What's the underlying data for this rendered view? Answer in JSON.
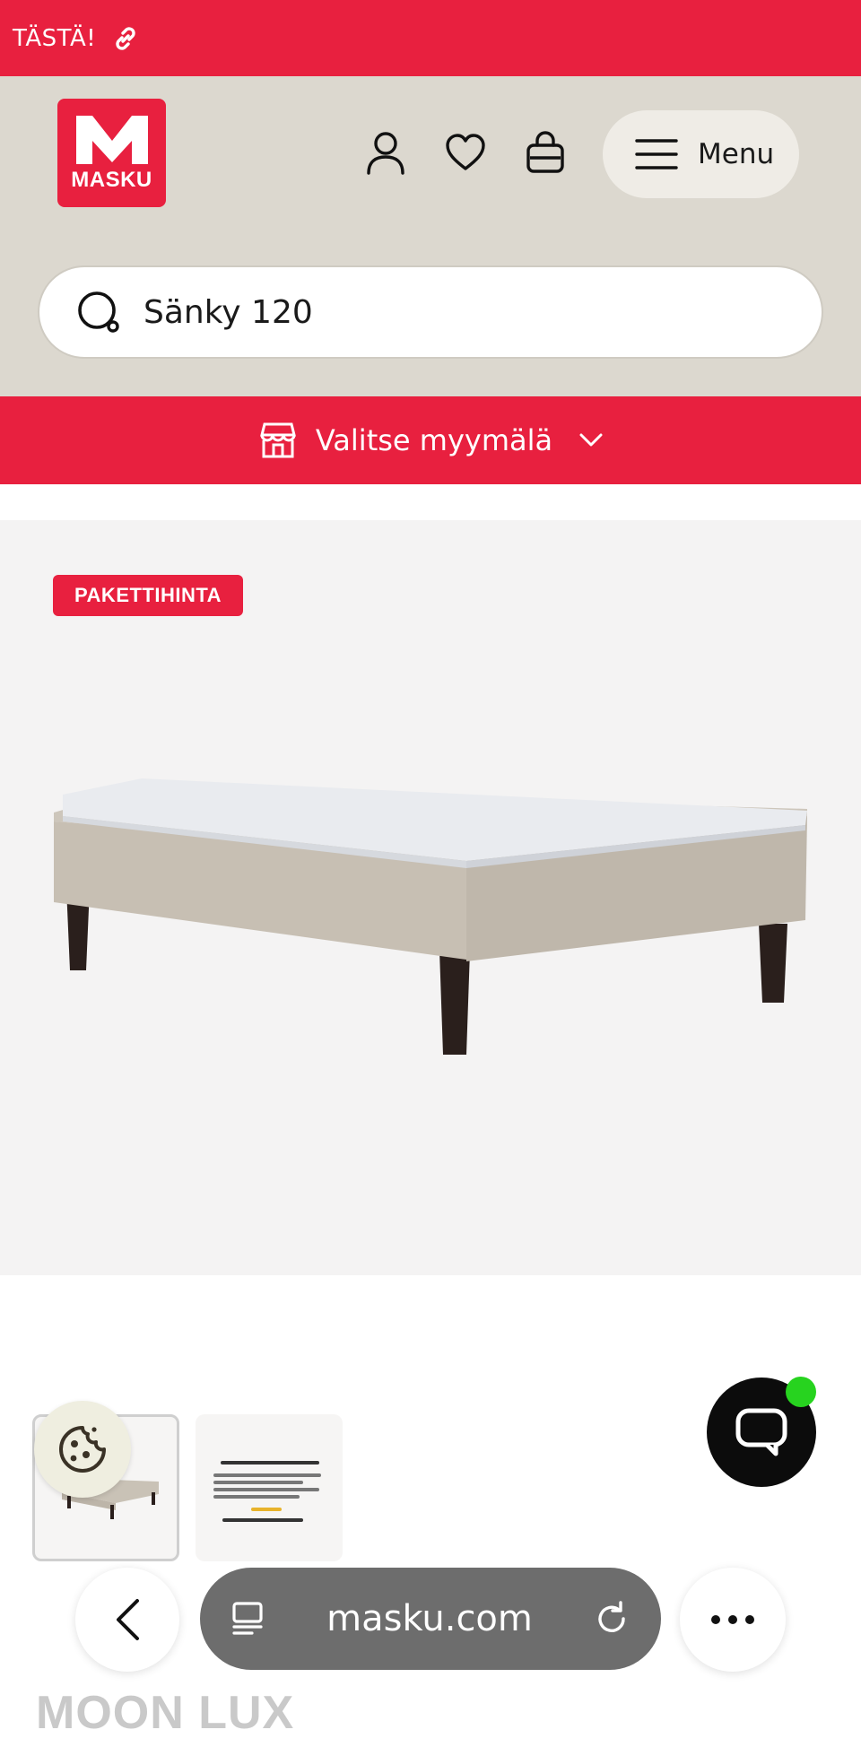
{
  "promo": {
    "text": "TÄSTÄ!",
    "icon": "link-icon"
  },
  "header": {
    "logo_text": "MASKU",
    "icons": [
      "account-icon",
      "wishlist-heart-icon",
      "cart-bag-icon"
    ],
    "menu_label": "Menu"
  },
  "search": {
    "value": "Sänky 120",
    "icon": "search-icon"
  },
  "store": {
    "label": "Valitse myymälä",
    "icon": "store-icon"
  },
  "product": {
    "badge": "PAKETTIHINTA",
    "title": "MOON LUX",
    "thumbnails": [
      "bed-image-thumbnail",
      "info-graphic-thumbnail"
    ]
  },
  "browser": {
    "url": "masku.com"
  },
  "colors": {
    "brand_red": "#e8203f",
    "header_beige": "#dcd8cf",
    "chat_online": "#27d31f"
  }
}
